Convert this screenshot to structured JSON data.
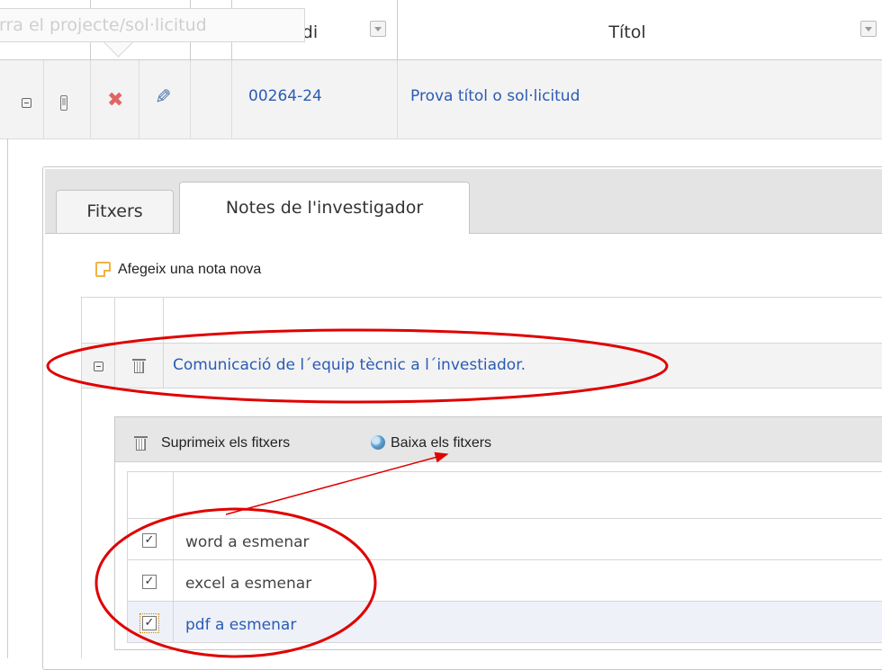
{
  "header": {
    "tooltip": "rra el projecte/sol·licitud",
    "col_codi": "Codi",
    "col_titol": "Títol"
  },
  "main_row": {
    "code": "00264-24",
    "title": "Prova títol o sol·licitud"
  },
  "tabs": [
    {
      "label": "Fitxers",
      "active": false
    },
    {
      "label": "Notes de l'investigador",
      "active": true
    }
  ],
  "notes": {
    "add_label": "Afegeix una nota nova",
    "items": [
      {
        "title": "Comunicació de l´equip tècnic a l´investiador."
      }
    ]
  },
  "files_toolbar": {
    "delete_label": "Suprimeix els fitxers",
    "download_label": "Baixa els fitxers"
  },
  "files": [
    {
      "name": "word a esmenar",
      "checked": true
    },
    {
      "name": "excel a esmenar",
      "checked": true
    },
    {
      "name": "pdf a esmenar",
      "checked": true
    }
  ],
  "colors": {
    "link": "#2a5bb5",
    "annotation": "#e00000",
    "delete_icon": "#e06666",
    "note_icon": "#f0b343"
  },
  "icons": [
    "collapse-icon",
    "mobile-icon",
    "delete-icon",
    "edit-icon",
    "note-icon",
    "trash-icon",
    "globe-icon",
    "checkbox-checked-icon"
  ]
}
